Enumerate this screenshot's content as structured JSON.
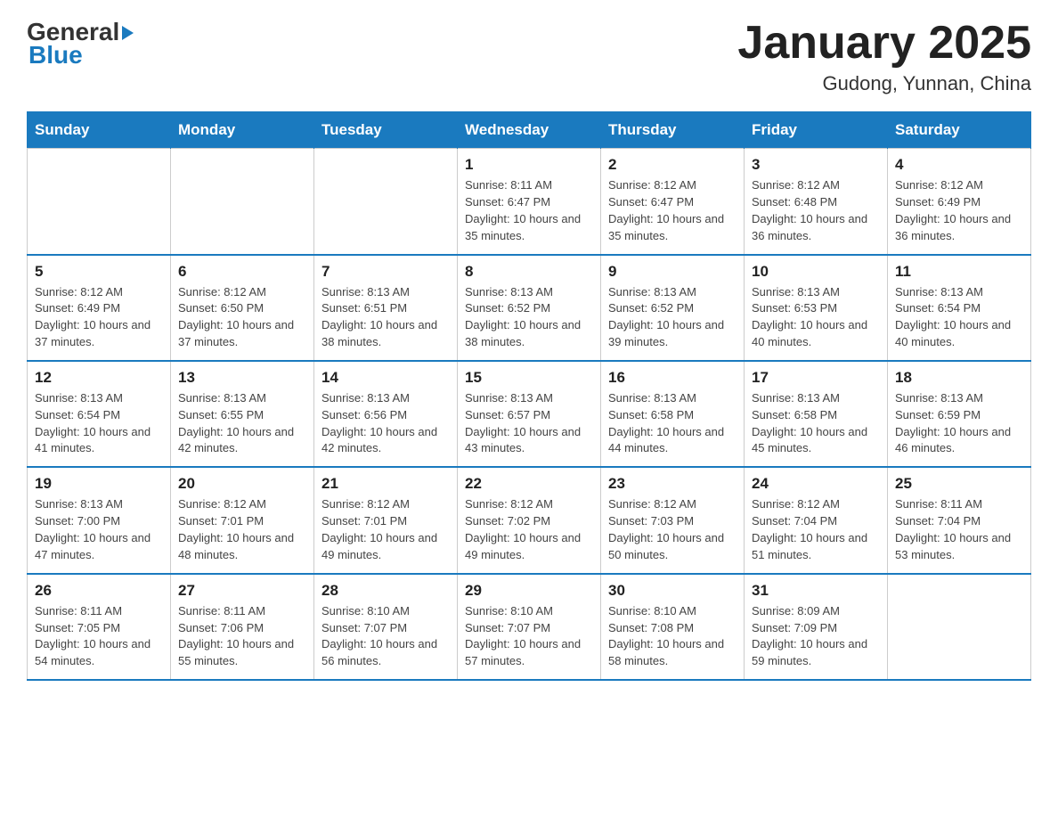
{
  "header": {
    "logo_general": "General",
    "logo_blue": "Blue",
    "title": "January 2025",
    "subtitle": "Gudong, Yunnan, China"
  },
  "days_of_week": [
    "Sunday",
    "Monday",
    "Tuesday",
    "Wednesday",
    "Thursday",
    "Friday",
    "Saturday"
  ],
  "weeks": [
    [
      {
        "day": "",
        "info": ""
      },
      {
        "day": "",
        "info": ""
      },
      {
        "day": "",
        "info": ""
      },
      {
        "day": "1",
        "info": "Sunrise: 8:11 AM\nSunset: 6:47 PM\nDaylight: 10 hours\nand 35 minutes."
      },
      {
        "day": "2",
        "info": "Sunrise: 8:12 AM\nSunset: 6:47 PM\nDaylight: 10 hours\nand 35 minutes."
      },
      {
        "day": "3",
        "info": "Sunrise: 8:12 AM\nSunset: 6:48 PM\nDaylight: 10 hours\nand 36 minutes."
      },
      {
        "day": "4",
        "info": "Sunrise: 8:12 AM\nSunset: 6:49 PM\nDaylight: 10 hours\nand 36 minutes."
      }
    ],
    [
      {
        "day": "5",
        "info": "Sunrise: 8:12 AM\nSunset: 6:49 PM\nDaylight: 10 hours\nand 37 minutes."
      },
      {
        "day": "6",
        "info": "Sunrise: 8:12 AM\nSunset: 6:50 PM\nDaylight: 10 hours\nand 37 minutes."
      },
      {
        "day": "7",
        "info": "Sunrise: 8:13 AM\nSunset: 6:51 PM\nDaylight: 10 hours\nand 38 minutes."
      },
      {
        "day": "8",
        "info": "Sunrise: 8:13 AM\nSunset: 6:52 PM\nDaylight: 10 hours\nand 38 minutes."
      },
      {
        "day": "9",
        "info": "Sunrise: 8:13 AM\nSunset: 6:52 PM\nDaylight: 10 hours\nand 39 minutes."
      },
      {
        "day": "10",
        "info": "Sunrise: 8:13 AM\nSunset: 6:53 PM\nDaylight: 10 hours\nand 40 minutes."
      },
      {
        "day": "11",
        "info": "Sunrise: 8:13 AM\nSunset: 6:54 PM\nDaylight: 10 hours\nand 40 minutes."
      }
    ],
    [
      {
        "day": "12",
        "info": "Sunrise: 8:13 AM\nSunset: 6:54 PM\nDaylight: 10 hours\nand 41 minutes."
      },
      {
        "day": "13",
        "info": "Sunrise: 8:13 AM\nSunset: 6:55 PM\nDaylight: 10 hours\nand 42 minutes."
      },
      {
        "day": "14",
        "info": "Sunrise: 8:13 AM\nSunset: 6:56 PM\nDaylight: 10 hours\nand 42 minutes."
      },
      {
        "day": "15",
        "info": "Sunrise: 8:13 AM\nSunset: 6:57 PM\nDaylight: 10 hours\nand 43 minutes."
      },
      {
        "day": "16",
        "info": "Sunrise: 8:13 AM\nSunset: 6:58 PM\nDaylight: 10 hours\nand 44 minutes."
      },
      {
        "day": "17",
        "info": "Sunrise: 8:13 AM\nSunset: 6:58 PM\nDaylight: 10 hours\nand 45 minutes."
      },
      {
        "day": "18",
        "info": "Sunrise: 8:13 AM\nSunset: 6:59 PM\nDaylight: 10 hours\nand 46 minutes."
      }
    ],
    [
      {
        "day": "19",
        "info": "Sunrise: 8:13 AM\nSunset: 7:00 PM\nDaylight: 10 hours\nand 47 minutes."
      },
      {
        "day": "20",
        "info": "Sunrise: 8:12 AM\nSunset: 7:01 PM\nDaylight: 10 hours\nand 48 minutes."
      },
      {
        "day": "21",
        "info": "Sunrise: 8:12 AM\nSunset: 7:01 PM\nDaylight: 10 hours\nand 49 minutes."
      },
      {
        "day": "22",
        "info": "Sunrise: 8:12 AM\nSunset: 7:02 PM\nDaylight: 10 hours\nand 49 minutes."
      },
      {
        "day": "23",
        "info": "Sunrise: 8:12 AM\nSunset: 7:03 PM\nDaylight: 10 hours\nand 50 minutes."
      },
      {
        "day": "24",
        "info": "Sunrise: 8:12 AM\nSunset: 7:04 PM\nDaylight: 10 hours\nand 51 minutes."
      },
      {
        "day": "25",
        "info": "Sunrise: 8:11 AM\nSunset: 7:04 PM\nDaylight: 10 hours\nand 53 minutes."
      }
    ],
    [
      {
        "day": "26",
        "info": "Sunrise: 8:11 AM\nSunset: 7:05 PM\nDaylight: 10 hours\nand 54 minutes."
      },
      {
        "day": "27",
        "info": "Sunrise: 8:11 AM\nSunset: 7:06 PM\nDaylight: 10 hours\nand 55 minutes."
      },
      {
        "day": "28",
        "info": "Sunrise: 8:10 AM\nSunset: 7:07 PM\nDaylight: 10 hours\nand 56 minutes."
      },
      {
        "day": "29",
        "info": "Sunrise: 8:10 AM\nSunset: 7:07 PM\nDaylight: 10 hours\nand 57 minutes."
      },
      {
        "day": "30",
        "info": "Sunrise: 8:10 AM\nSunset: 7:08 PM\nDaylight: 10 hours\nand 58 minutes."
      },
      {
        "day": "31",
        "info": "Sunrise: 8:09 AM\nSunset: 7:09 PM\nDaylight: 10 hours\nand 59 minutes."
      },
      {
        "day": "",
        "info": ""
      }
    ]
  ]
}
